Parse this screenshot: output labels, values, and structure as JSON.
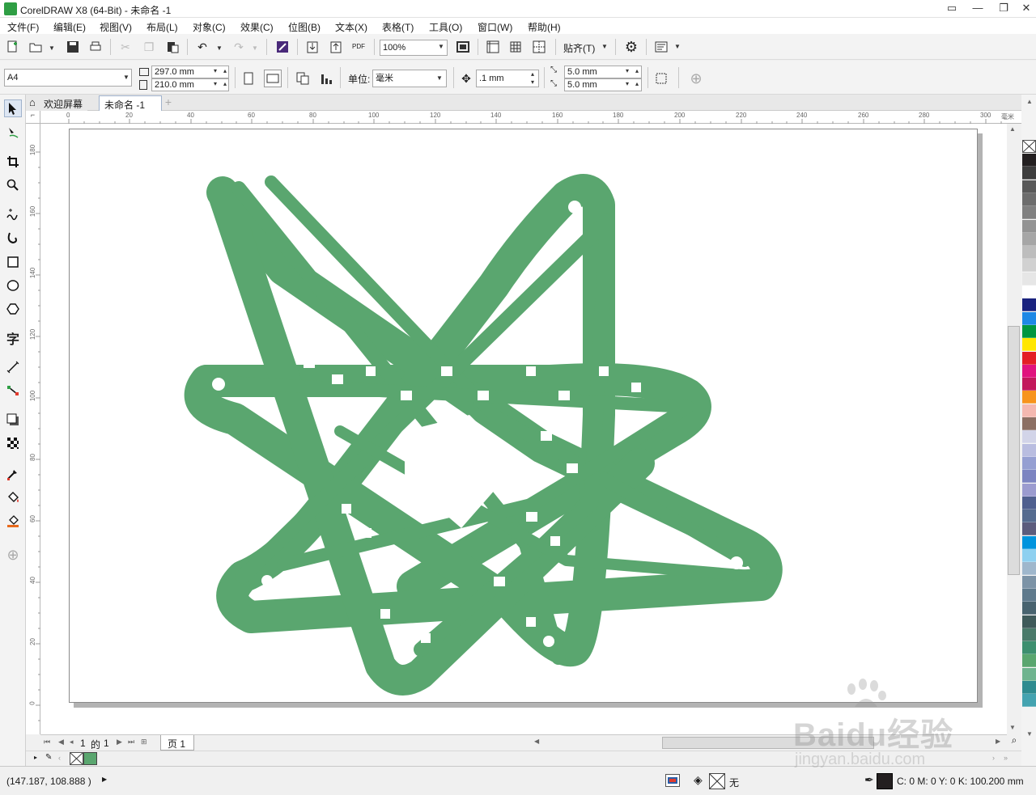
{
  "window": {
    "title": "CorelDRAW X8 (64-Bit) - 未命名 -1",
    "controls": [
      "▭",
      "—",
      "❐",
      "✕"
    ]
  },
  "menu": [
    "文件(F)",
    "编辑(E)",
    "视图(V)",
    "布局(L)",
    "对象(C)",
    "效果(C)",
    "位图(B)",
    "文本(X)",
    "表格(T)",
    "工具(O)",
    "窗口(W)",
    "帮助(H)"
  ],
  "toolbar": {
    "zoom_value": "100%",
    "snap_label": "贴齐(T)",
    "pdf_label": "PDF"
  },
  "propertybar": {
    "page_size": "A4",
    "width": "297.0 mm",
    "height": "210.0 mm",
    "unit_label": "单位:",
    "unit_value": "毫米",
    "nudge": ".1 mm",
    "dup_x": "5.0 mm",
    "dup_y": "5.0 mm"
  },
  "tabs": {
    "welcome": "欢迎屏幕",
    "document": "未命名 -1"
  },
  "rulers": {
    "h_ticks": [
      "0",
      "20",
      "40",
      "60",
      "80",
      "100",
      "120",
      "140",
      "160",
      "180",
      "200",
      "220",
      "240",
      "260",
      "280",
      "300"
    ],
    "h_unit": "毫米",
    "v_ticks": [
      "180",
      "160",
      "140",
      "120",
      "100",
      "80",
      "60",
      "40",
      "20",
      "0"
    ]
  },
  "pagenav": {
    "current": "1",
    "of_label": "的",
    "total": "1",
    "page_tab": "页 1"
  },
  "status": {
    "coords": "(147.187, 108.888 )",
    "fill_none": "无",
    "outline_color": "C: 0 M: 0 Y: 0 K: 100",
    "outline_width": ".200 mm"
  },
  "colors": {
    "shape_fill": "#5aa66f",
    "accent": "#2f9e44"
  },
  "palette": [
    "#231f20",
    "#3d3d3d",
    "#595959",
    "#6d6d6d",
    "#808080",
    "#939393",
    "#a6a6a6",
    "#bdbdbd",
    "#d1d1d1",
    "#e6e6e6",
    "#ffffff",
    "#1a237e",
    "#1e88e5",
    "#00963f",
    "#ffe600",
    "#e31e24",
    "#e0137e",
    "#c2185b",
    "#f7941d",
    "#f4b8b0",
    "#8c6f63",
    "#d2d4e8",
    "#b9bde0",
    "#959fd2",
    "#7c84c1",
    "#9b9bcf",
    "#4f5f8f",
    "#556b8f",
    "#5c5c7d",
    "#0093dd",
    "#8ed0f0",
    "#9fb7cc",
    "#7c93a6",
    "#5f7a8c",
    "#48636f",
    "#3f5a5a",
    "#4a7a6a",
    "#3d8f6f",
    "#5aa66f",
    "#6fb48f",
    "#2e8b8f",
    "#44a3b0"
  ],
  "watermark": {
    "brand": "Baidu经验",
    "url": "jingyan.baidu.com"
  }
}
